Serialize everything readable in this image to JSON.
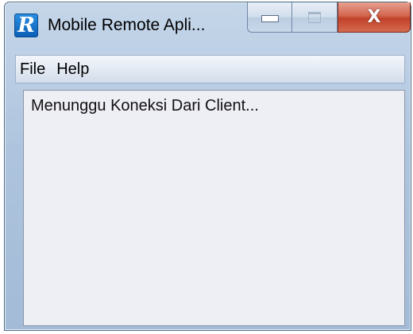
{
  "window": {
    "title": "Mobile Remote Apli...",
    "app_icon_glyph": "R",
    "app_icon_name": "app-logo-icon",
    "caption_buttons": {
      "minimize_glyph": "minimize-icon",
      "maximize_glyph": "maximize-icon",
      "close_glyph_text": "X",
      "close_color": "#c8452d"
    }
  },
  "menu": {
    "items": [
      {
        "label": "File"
      },
      {
        "label": "Help"
      }
    ]
  },
  "content": {
    "status_text": "Menunggu Koneksi Dari Client..."
  },
  "colors": {
    "frame": "#aec4de",
    "content_bg": "#eeeef5",
    "app_icon": "#1a78d0"
  }
}
